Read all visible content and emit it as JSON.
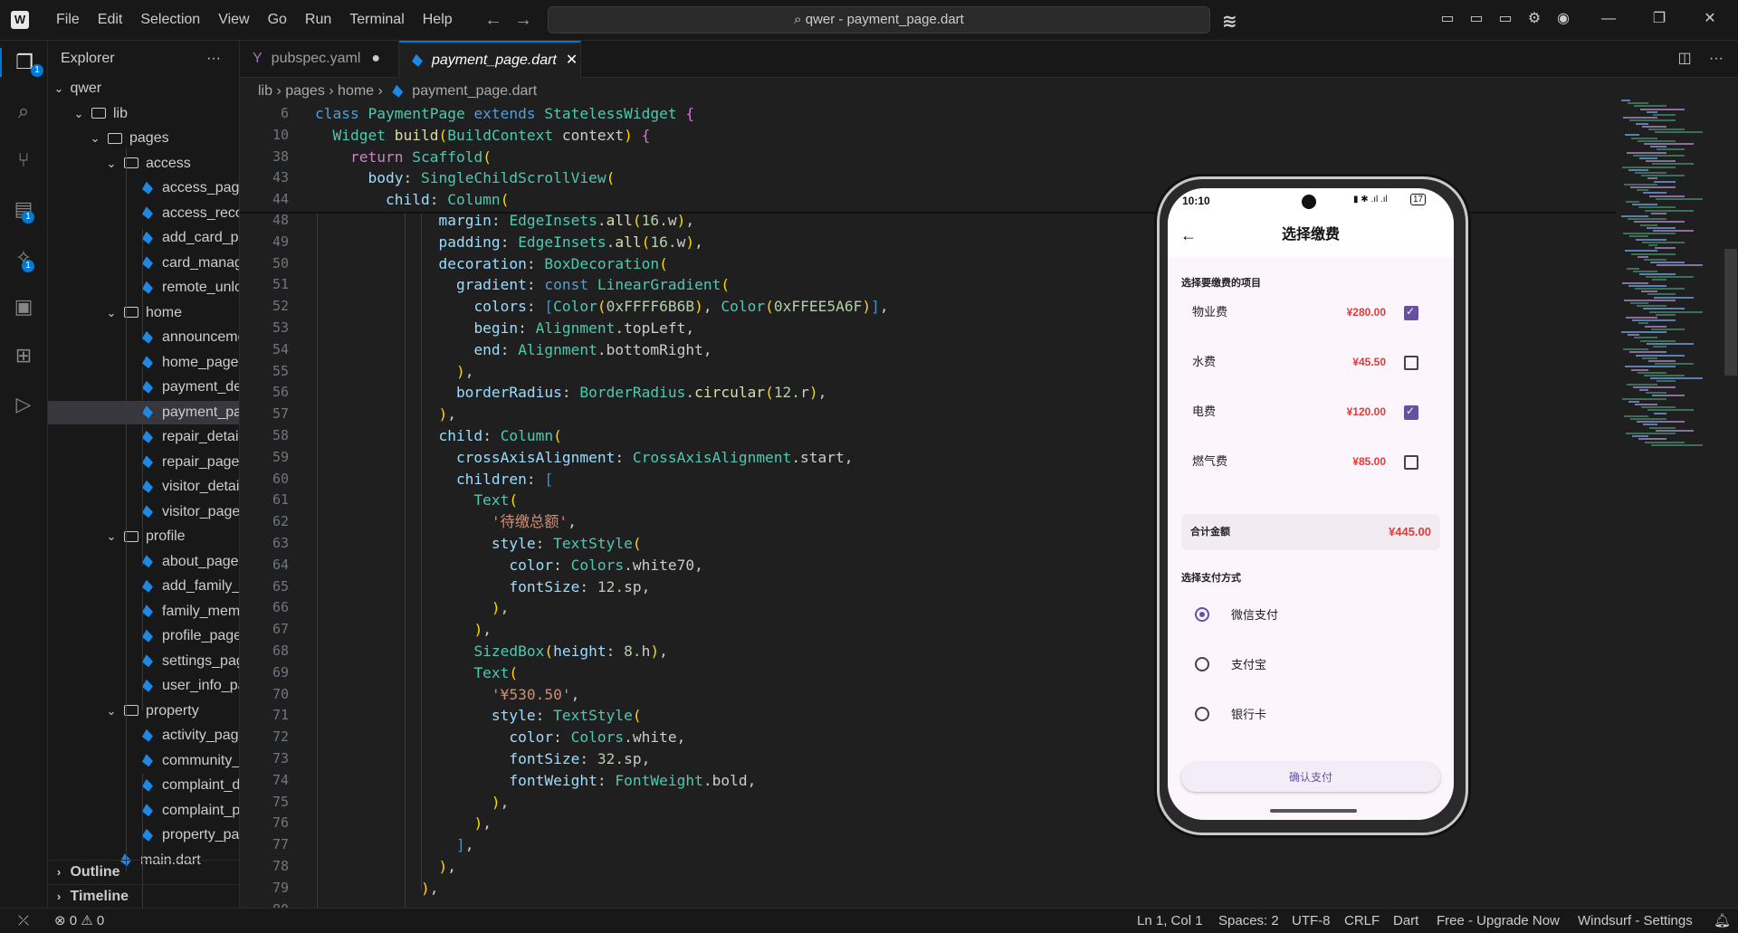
{
  "menu": [
    "File",
    "Edit",
    "Selection",
    "View",
    "Go",
    "Run",
    "Terminal",
    "Help"
  ],
  "search": {
    "text": "qwer - payment_page.dart"
  },
  "explorer": {
    "title": "Explorer",
    "root": "qwer",
    "items": [
      {
        "label": "lib",
        "kind": "folder",
        "depth": 1
      },
      {
        "label": "pages",
        "kind": "folder",
        "depth": 2
      },
      {
        "label": "access",
        "kind": "folder",
        "depth": 3
      },
      {
        "label": "access_page....",
        "kind": "file",
        "depth": 4
      },
      {
        "label": "access_record...",
        "kind": "file",
        "depth": 4
      },
      {
        "label": "add_card_pag...",
        "kind": "file",
        "depth": 4
      },
      {
        "label": "card_manage...",
        "kind": "file",
        "depth": 4
      },
      {
        "label": "remote_unloc...",
        "kind": "file",
        "depth": 4
      },
      {
        "label": "home",
        "kind": "folder",
        "depth": 3
      },
      {
        "label": "announceme...",
        "kind": "file",
        "depth": 4
      },
      {
        "label": "home_page.d...",
        "kind": "file",
        "depth": 4
      },
      {
        "label": "payment_det...",
        "kind": "file",
        "depth": 4
      },
      {
        "label": "payment_pag...",
        "kind": "file",
        "depth": 4,
        "selected": true
      },
      {
        "label": "repair_detail_...",
        "kind": "file",
        "depth": 4
      },
      {
        "label": "repair_page.d...",
        "kind": "file",
        "depth": 4
      },
      {
        "label": "visitor_detail_...",
        "kind": "file",
        "depth": 4
      },
      {
        "label": "visitor_page.d...",
        "kind": "file",
        "depth": 4
      },
      {
        "label": "profile",
        "kind": "folder",
        "depth": 3
      },
      {
        "label": "about_page.d...",
        "kind": "file",
        "depth": 4
      },
      {
        "label": "add_family_m...",
        "kind": "file",
        "depth": 4
      },
      {
        "label": "family_memb...",
        "kind": "file",
        "depth": 4
      },
      {
        "label": "profile_page....",
        "kind": "file",
        "depth": 4
      },
      {
        "label": "settings_page...",
        "kind": "file",
        "depth": 4
      },
      {
        "label": "user_info_pag...",
        "kind": "file",
        "depth": 4
      },
      {
        "label": "property",
        "kind": "folder",
        "depth": 3
      },
      {
        "label": "activity_page....",
        "kind": "file",
        "depth": 4
      },
      {
        "label": "community_i...",
        "kind": "file",
        "depth": 4
      },
      {
        "label": "complaint_de...",
        "kind": "file",
        "depth": 4
      },
      {
        "label": "complaint_pa...",
        "kind": "file",
        "depth": 4
      },
      {
        "label": "property_pag...",
        "kind": "file",
        "depth": 4
      },
      {
        "label": "main.dart",
        "kind": "file",
        "depth": 3
      }
    ],
    "outline": "Outline",
    "timeline": "Timeline"
  },
  "tabs": [
    {
      "label": "pubspec.yaml",
      "icon": "Y"
    },
    {
      "label": "payment_page.dart"
    }
  ],
  "breadcrumb": [
    "lib",
    "pages",
    "home",
    "payment_page.dart"
  ],
  "sticky_lines": [
    {
      "n": "6",
      "t": "class PaymentPage extends StatelessWidget {"
    },
    {
      "n": "10",
      "t": "  Widget build(BuildContext context) {"
    },
    {
      "n": "38",
      "t": "    return Scaffold("
    },
    {
      "n": "43",
      "t": "      body: SingleChildScrollView("
    },
    {
      "n": "44",
      "t": "        child: Column("
    }
  ],
  "code_lines": [
    {
      "n": "48",
      "t": "              margin: EdgeInsets.all(16.w),"
    },
    {
      "n": "49",
      "t": "              padding: EdgeInsets.all(16.w),"
    },
    {
      "n": "50",
      "t": "              decoration: BoxDecoration("
    },
    {
      "n": "51",
      "t": "                gradient: const LinearGradient("
    },
    {
      "n": "52",
      "t": "                  colors: [Color(0xFFFF6B6B), Color(0xFFEE5A6F)],"
    },
    {
      "n": "53",
      "t": "                  begin: Alignment.topLeft,"
    },
    {
      "n": "54",
      "t": "                  end: Alignment.bottomRight,"
    },
    {
      "n": "55",
      "t": "                ),"
    },
    {
      "n": "56",
      "t": "                borderRadius: BorderRadius.circular(12.r),"
    },
    {
      "n": "57",
      "t": "              ),"
    },
    {
      "n": "58",
      "t": "              child: Column("
    },
    {
      "n": "59",
      "t": "                crossAxisAlignment: CrossAxisAlignment.start,"
    },
    {
      "n": "60",
      "t": "                children: ["
    },
    {
      "n": "61",
      "t": "                  Text("
    },
    {
      "n": "62",
      "t": "                    '待缴总额',"
    },
    {
      "n": "63",
      "t": "                    style: TextStyle("
    },
    {
      "n": "64",
      "t": "                      color: Colors.white70,"
    },
    {
      "n": "65",
      "t": "                      fontSize: 12.sp,"
    },
    {
      "n": "66",
      "t": "                    ),"
    },
    {
      "n": "67",
      "t": "                  ),"
    },
    {
      "n": "68",
      "t": "                  SizedBox(height: 8.h),"
    },
    {
      "n": "69",
      "t": "                  Text("
    },
    {
      "n": "70",
      "t": "                    '¥530.50',"
    },
    {
      "n": "71",
      "t": "                    style: TextStyle("
    },
    {
      "n": "72",
      "t": "                      color: Colors.white,"
    },
    {
      "n": "73",
      "t": "                      fontSize: 32.sp,"
    },
    {
      "n": "74",
      "t": "                      fontWeight: FontWeight.bold,"
    },
    {
      "n": "75",
      "t": "                    ),"
    },
    {
      "n": "76",
      "t": "                  ),"
    },
    {
      "n": "77",
      "t": "                ],"
    },
    {
      "n": "78",
      "t": "              ),"
    },
    {
      "n": "79",
      "t": "            ),"
    },
    {
      "n": "80",
      "t": ""
    }
  ],
  "status": {
    "errors": "0",
    "warnings": "0",
    "position": "Ln 1, Col 1",
    "spaces": "Spaces: 2",
    "encoding": "UTF-8",
    "eol": "CRLF",
    "language": "Dart",
    "plan": "Free - Upgrade Now",
    "settings": "Windsurf - Settings"
  },
  "phone": {
    "time": "10:10",
    "battery": "17",
    "title": "选择缴费",
    "section_items": "选择要缴费的项目",
    "items": [
      {
        "label": "物业费",
        "price": "¥280.00",
        "checked": true
      },
      {
        "label": "水费",
        "price": "¥45.50",
        "checked": false
      },
      {
        "label": "电费",
        "price": "¥120.00",
        "checked": true
      },
      {
        "label": "燃气费",
        "price": "¥85.00",
        "checked": false
      }
    ],
    "total_label": "合计金额",
    "total_value": "¥445.00",
    "section_pay": "选择支付方式",
    "methods": [
      {
        "label": "微信支付",
        "selected": true
      },
      {
        "label": "支付宝",
        "selected": false
      },
      {
        "label": "银行卡",
        "selected": false
      }
    ],
    "confirm": "确认支付"
  },
  "colors": {
    "accent": "#0078d4",
    "primary_phone": "#6750a4",
    "price": "#e53935"
  }
}
